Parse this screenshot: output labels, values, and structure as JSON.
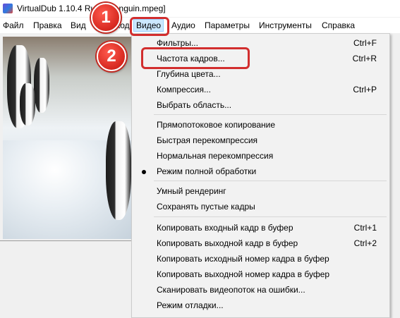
{
  "window": {
    "title": "VirtualDub 1.10.4 Rus - [penguin.mpeg]"
  },
  "menubar": {
    "items": [
      "Файл",
      "Правка",
      "Вид",
      "Переход",
      "Видео",
      "Аудио",
      "Параметры",
      "Инструменты",
      "Справка"
    ],
    "active": "Видео"
  },
  "video_menu": {
    "items": [
      {
        "label": "Фильтры...",
        "shortcut": "Ctrl+F"
      },
      {
        "label": "Частота кадров...",
        "shortcut": "Ctrl+R"
      },
      {
        "label": "Глубина цвета...",
        "shortcut": ""
      },
      {
        "label": "Компрессия...",
        "shortcut": "Ctrl+P"
      },
      {
        "label": "Выбрать область...",
        "shortcut": ""
      },
      {
        "label": "Прямопотоковое копирование",
        "shortcut": ""
      },
      {
        "label": "Быстрая перекомпрессия",
        "shortcut": ""
      },
      {
        "label": "Нормальная перекомпрессия",
        "shortcut": ""
      },
      {
        "label": "Режим полной обработки",
        "shortcut": "",
        "checked": true
      },
      {
        "label": "Умный рендеринг",
        "shortcut": ""
      },
      {
        "label": "Сохранять пустые кадры",
        "shortcut": ""
      },
      {
        "label": "Копировать входный кадр в буфер",
        "shortcut": "Ctrl+1"
      },
      {
        "label": "Копировать выходной кадр в буфер",
        "shortcut": "Ctrl+2"
      },
      {
        "label": "Копировать исходный номер кадра в буфер",
        "shortcut": ""
      },
      {
        "label": "Копировать выходной номер кадра в буфер",
        "shortcut": ""
      },
      {
        "label": "Сканировать видеопоток на ошибки...",
        "shortcut": ""
      },
      {
        "label": "Режим отладки...",
        "shortcut": ""
      }
    ]
  },
  "annotations": {
    "step1": "1",
    "step2": "2",
    "color": "#d22e2e"
  },
  "colors": {
    "menu_active_bg": "#cce8ff",
    "menu_bg": "#f2f2f2"
  }
}
